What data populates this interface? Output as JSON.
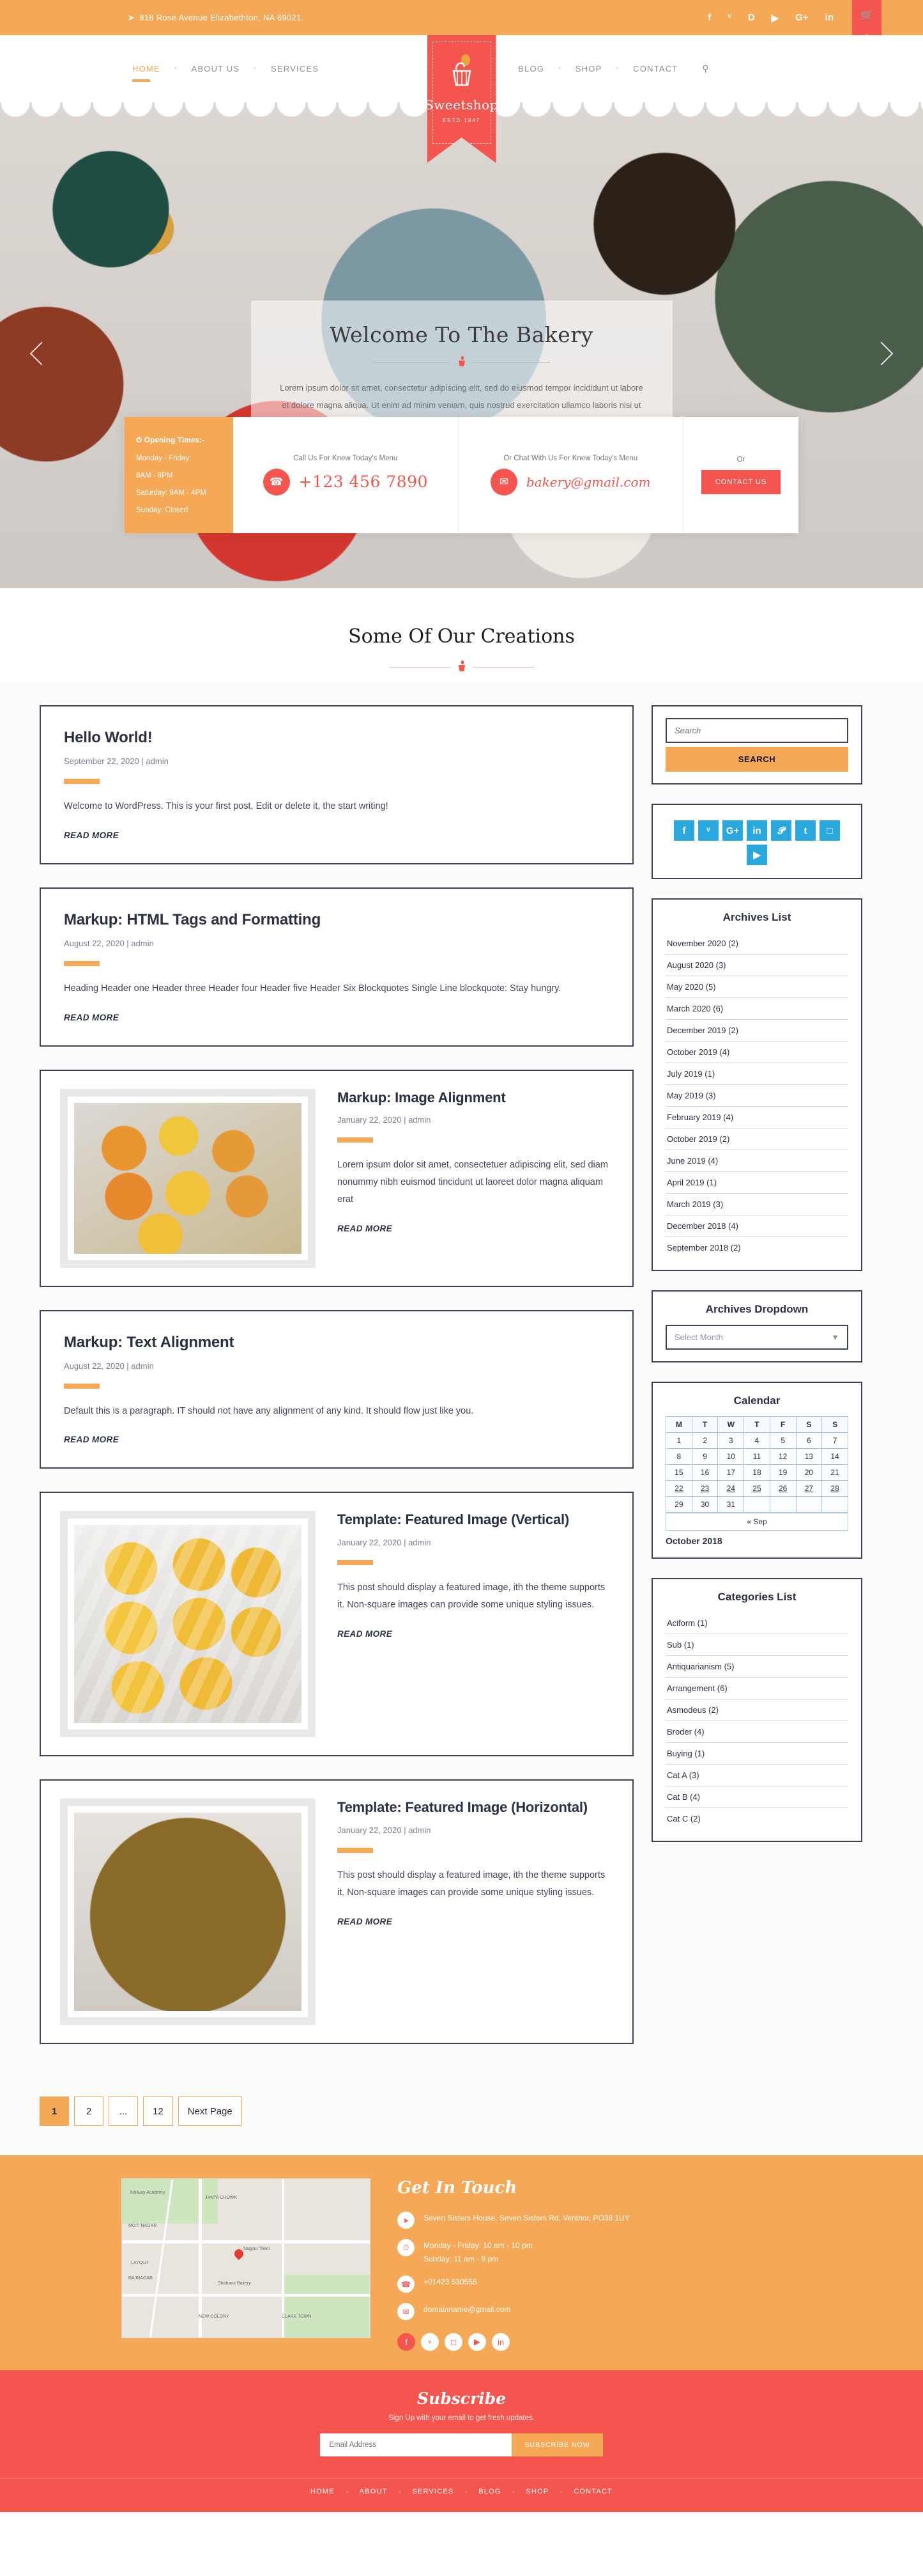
{
  "topbar": {
    "address": "818 Rose Avenue Elizabethton, NA 69021.",
    "location_icon": "paper-plane-icon",
    "socials": [
      {
        "name": "facebook-icon",
        "glyph": "f"
      },
      {
        "name": "twitter-icon",
        "glyph": "ᵛ"
      },
      {
        "name": "dribbble-icon",
        "glyph": "D"
      },
      {
        "name": "youtube-icon",
        "glyph": "▶"
      },
      {
        "name": "google-plus-icon",
        "glyph": "G+"
      },
      {
        "name": "linkedin-icon",
        "glyph": "in"
      }
    ],
    "cart_icon": "shopping-cart-icon"
  },
  "nav": {
    "left": [
      "HOME",
      "ABOUT US",
      "SERVICES"
    ],
    "right": [
      "BLOG",
      "SHOP",
      "CONTACT"
    ],
    "active": "HOME",
    "search_icon": "search-icon"
  },
  "logo": {
    "brand": "Sweetshop",
    "estd": "ESTD    1947",
    "icon": "cupcake-icon"
  },
  "hero": {
    "title": "Welcome To The Bakery",
    "text": "Lorem ipsum dolor sit amet, consectetur adipiscing elit, sed do eiusmod tempor incididunt ut labore et dolore magna aliqua. Ut enim ad minim veniam, quis nostrud exercitation ullamco laboris nisi ut aliquip.",
    "prev_icon": "chevron-left-icon",
    "next_icon": "chevron-right-icon",
    "divider_icon": "cupcake-icon"
  },
  "strip": {
    "opening_title": "Opening Times:-",
    "opening_icon": "clock-icon",
    "opening_lines": [
      "Monday - Friday:",
      "8AM - 8PM",
      "Saturday: 9AM - 4PM",
      "Sunday: Closed"
    ],
    "call_label": "Call Us For Knew Today's Menu",
    "phone": "+123 456 7890",
    "phone_icon": "phone-icon",
    "chat_label": "Or Chat With Us For Knew Today's Menu",
    "email": "bakery@gmail.com",
    "email_icon": "envelope-icon",
    "or_label": "Or",
    "contact_button": "CONTACT US"
  },
  "section": {
    "title": "Some Of Our Creations",
    "divider_icon": "cupcake-icon"
  },
  "posts": [
    {
      "title": "Hello World!",
      "meta": "September 22, 2020 | admin",
      "body": "Welcome to WordPress. This is your first post, Edit or delete it, the start writing!",
      "read_more": "READ MORE",
      "layout": "text"
    },
    {
      "title": "Markup: HTML Tags and Formatting",
      "meta": "August 22, 2020 | admin",
      "body": "Heading Header one Header three Header four Header five Header Six Blockquotes Single Line blockquote: Stay hungry.",
      "read_more": "READ MORE",
      "layout": "text"
    },
    {
      "title": "Markup: Image Alignment",
      "meta": "January 22, 2020 | admin",
      "body": "Lorem ipsum dolor sit amet, consectetuer adipiscing elit, sed diam nonummy nibh euismod tincidunt ut laoreet dolor magna aliquam erat",
      "read_more": "READ MORE",
      "layout": "media",
      "image": "tray-of-laddu-and-sweets"
    },
    {
      "title": "Markup: Text Alignment",
      "meta": "August 22, 2020 | admin",
      "body": "Default this is a paragraph. IT should not have any alignment of any kind. It should flow just like you.",
      "read_more": "READ MORE",
      "layout": "text"
    },
    {
      "title": "Template: Featured Image (Vertical)",
      "meta": "January 22, 2020 | admin",
      "body": "This post should display a featured image, ith the theme supports it. Non-square images can provide some unique styling issues.",
      "read_more": "READ MORE",
      "layout": "media",
      "image": "tray-of-boondi-laddu"
    },
    {
      "title": "Template: Featured Image (Horizontal)",
      "meta": "January 22, 2020 | admin",
      "body": "This post should display a featured image, ith the theme supports it. Non-square images can provide some unique styling issues.",
      "read_more": "READ MORE",
      "layout": "media",
      "image": "bowl-of-rasgulla"
    }
  ],
  "pagination": {
    "pages": [
      "1",
      "2",
      "...",
      "12"
    ],
    "current": "1",
    "next_label": "Next Page"
  },
  "sidebar": {
    "search": {
      "placeholder": "Search",
      "button": "SEARCH",
      "value": ""
    },
    "social_icons": [
      {
        "name": "facebook-icon",
        "glyph": "f"
      },
      {
        "name": "twitter-icon",
        "glyph": "ᵛ"
      },
      {
        "name": "google-plus-icon",
        "glyph": "G+"
      },
      {
        "name": "linkedin-icon",
        "glyph": "in"
      },
      {
        "name": "pinterest-icon",
        "glyph": "𝓟"
      },
      {
        "name": "tumblr-icon",
        "glyph": "t"
      },
      {
        "name": "instagram-icon",
        "glyph": "□"
      },
      {
        "name": "youtube-icon",
        "glyph": "▶"
      }
    ],
    "archives_list": {
      "title": "Archives List",
      "items": [
        "November 2020 (2)",
        "August 2020 (3)",
        "May 2020 (5)",
        "March 2020 (6)",
        "December 2019 (2)",
        "October 2019 (4)",
        "July 2019 (1)",
        "May 2019 (3)",
        "February 2019 (4)",
        "October 2019 (2)",
        "June 2019 (4)",
        "April 2019 (1)",
        "March 2019 (3)",
        "December 2018 (4)",
        "September 2018 (2)"
      ]
    },
    "archives_dropdown": {
      "title": "Archives Dropdown",
      "selected": "Select Month",
      "caret_icon": "chevron-down-icon"
    },
    "calendar": {
      "title": "Calendar",
      "weekdays": [
        "M",
        "T",
        "W",
        "T",
        "F",
        "S",
        "S"
      ],
      "weeks": [
        [
          "1",
          "2",
          "3",
          "4",
          "5",
          "6",
          "7"
        ],
        [
          "8",
          "9",
          "10",
          "11",
          "12",
          "13",
          "14"
        ],
        [
          "15",
          "16",
          "17",
          "18",
          "19",
          "20",
          "21"
        ],
        [
          "22",
          "23",
          "24",
          "25",
          "26",
          "27",
          "28"
        ],
        [
          "29",
          "30",
          "31",
          "",
          "",
          "",
          ""
        ]
      ],
      "underlined": [
        "22",
        "23",
        "24",
        "25",
        "26",
        "27",
        "28"
      ],
      "prev_label": "« Sep",
      "caption": "October 2018"
    },
    "categories": {
      "title": "Categories List",
      "items": [
        "Aciform (1)",
        "Sub (1)",
        "Antiquarianism (5)",
        "Arrangement (6)",
        "Asmodeus (2)",
        "Broder (4)",
        "Buying (1)",
        "Cat A (3)",
        "Cat B (4)",
        "Cat C (2)"
      ]
    }
  },
  "footer": {
    "map_labels": [
      "MOTI NAGAR",
      "JANTA CHOWK",
      "LAYOUT",
      "RAJNAGAR",
      "NEW COLONY",
      "CLARK TOWN",
      "Nagpur Town",
      "Shahana Bakery",
      "Railway Academy"
    ],
    "get_in_touch": {
      "title": "Get In Touch",
      "address": "Seven Sisters House, Seven Sisters Rd, Ventnor, PO38 1UY",
      "address_icon": "location-icon",
      "hours": "Monday - Friday: 10 am - 10 pm\nSunday: 11 am - 9 pm",
      "hours_icon": "clock-icon",
      "phone": "+01423 530555",
      "phone_icon": "phone-icon",
      "email": "domainname@gmail.com",
      "email_icon": "envelope-icon",
      "socials": [
        {
          "name": "facebook-icon",
          "glyph": "f",
          "active": true
        },
        {
          "name": "twitter-icon",
          "glyph": "ᵛ",
          "active": false
        },
        {
          "name": "instagram-icon",
          "glyph": "□",
          "active": false
        },
        {
          "name": "youtube-icon",
          "glyph": "▶",
          "active": false
        },
        {
          "name": "linkedin-icon",
          "glyph": "in",
          "active": false
        }
      ]
    },
    "subscribe": {
      "title": "Subscribe",
      "subtitle": "Sign Up with your email to get fresh updates.",
      "placeholder": "Email Address",
      "value": "",
      "button": "SUBSCRIBE NOW"
    },
    "bottom_nav": [
      "HOME",
      "ABOUT",
      "SERVICES",
      "BLOG",
      "SHOP",
      "CONTACT"
    ]
  },
  "colors": {
    "orange": "#f5a855",
    "red": "#f4564f",
    "dark": "#2b3044",
    "social_blue": "#29a8e0"
  }
}
